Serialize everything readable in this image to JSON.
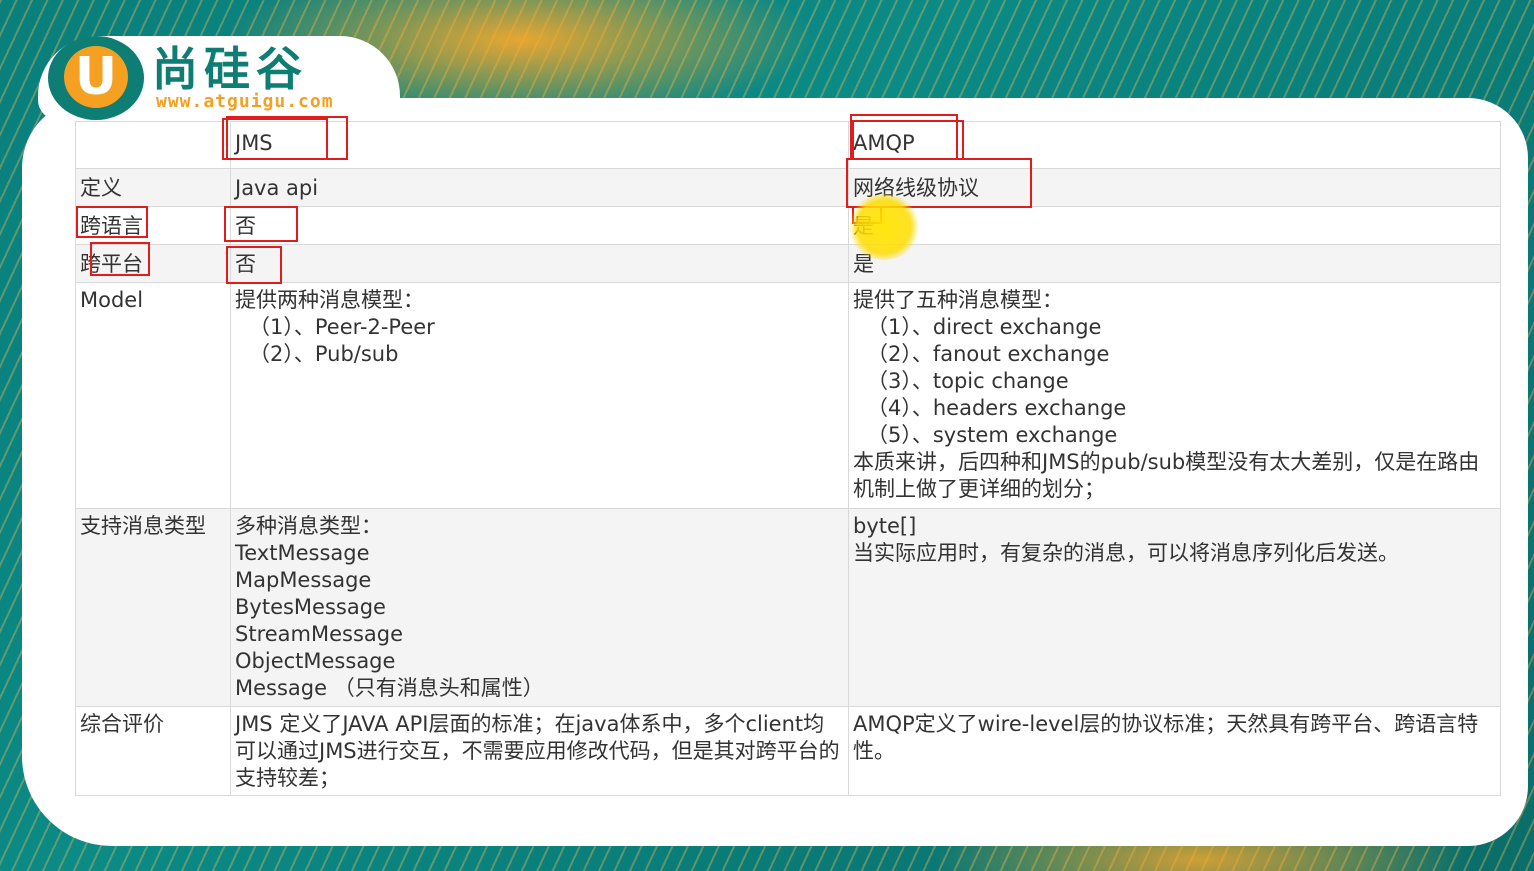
{
  "logo": {
    "mark": "U",
    "name": "尚硅谷",
    "url": "www.atguigu.com"
  },
  "table": {
    "header": {
      "c1": "",
      "jms": "JMS",
      "amqp": "AMQP"
    },
    "rows": [
      {
        "label": "定义",
        "jms": [
          "Java api"
        ],
        "amqp": [
          "网络线级协议"
        ]
      },
      {
        "label": "跨语言",
        "jms": [
          "否"
        ],
        "amqp": [
          "是"
        ]
      },
      {
        "label": "跨平台",
        "jms": [
          "否"
        ],
        "amqp": [
          "是"
        ]
      },
      {
        "label": "Model",
        "jms": [
          "提供两种消息模型：",
          "（1）、Peer-2-Peer",
          "（2）、Pub/sub"
        ],
        "amqp": [
          "提供了五种消息模型：",
          "（1）、direct exchange",
          "（2）、fanout exchange",
          "（3）、topic change",
          "（4）、headers exchange",
          "（5）、system exchange",
          "本质来讲，后四种和JMS的pub/sub模型没有太大差别，仅是在路由机制上做了更详细的划分；"
        ]
      },
      {
        "label": "支持消息类型",
        "jms": [
          "多种消息类型：",
          "TextMessage",
          "MapMessage",
          "BytesMessage",
          "StreamMessage",
          "ObjectMessage",
          "Message （只有消息头和属性）"
        ],
        "amqp": [
          "byte[]",
          "当实际应用时，有复杂的消息，可以将消息序列化后发送。"
        ]
      },
      {
        "label": "综合评价",
        "jms": [
          "JMS 定义了JAVA API层面的标准；在java体系中，多个client均可以通过JMS进行交互，不需要应用修改代码，但是其对跨平台的支持较差；"
        ],
        "amqp": [
          "AMQP定义了wire-level层的协议标准；天然具有跨平台、跨语言特性。"
        ]
      }
    ]
  },
  "colors": {
    "teal": "#0e7d74",
    "orange": "#f5a020",
    "annotation_red": "#e01c1c",
    "pointer_yellow": "#ffe000"
  }
}
